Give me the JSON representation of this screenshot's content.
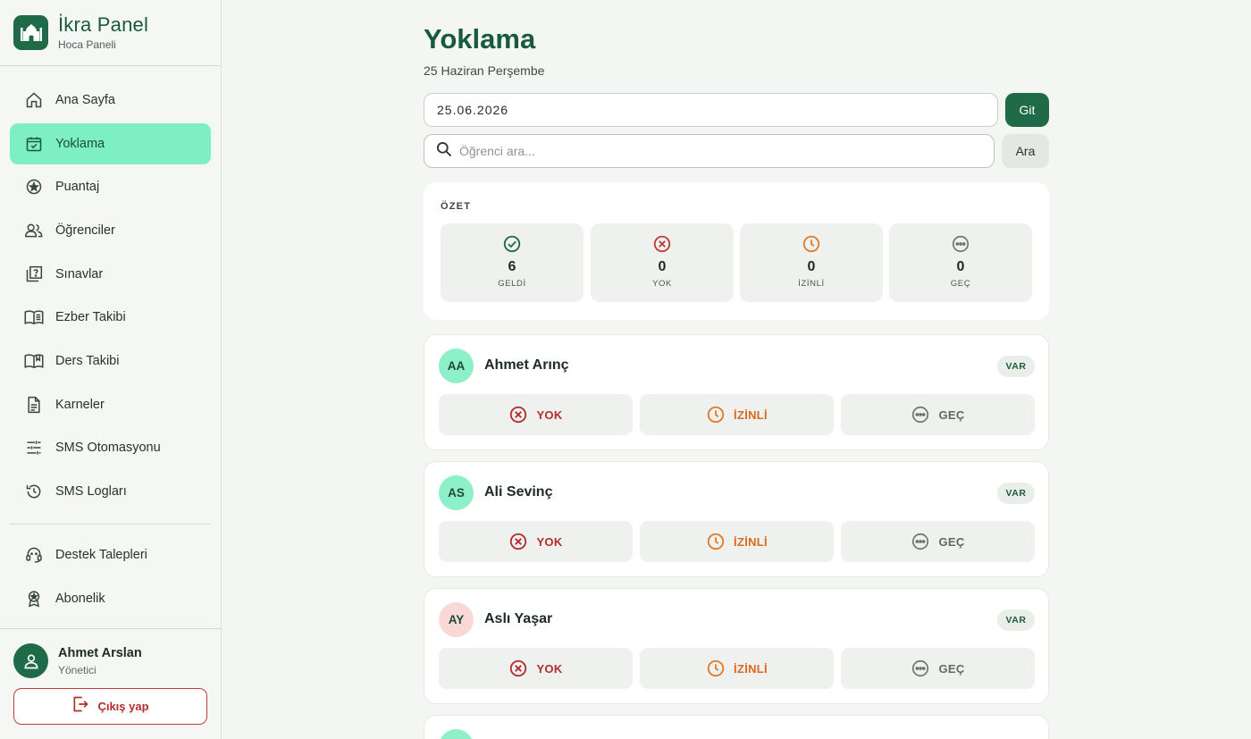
{
  "brand": {
    "title": "İkra Panel",
    "subtitle": "Hoca Paneli",
    "logo_icon": "mosque-icon"
  },
  "sidebar": {
    "items": [
      {
        "label": "Ana Sayfa",
        "icon": "home-icon",
        "active": false
      },
      {
        "label": "Yoklama",
        "icon": "calendar-check-icon",
        "active": true
      },
      {
        "label": "Puantaj",
        "icon": "star-circle-icon",
        "active": false
      },
      {
        "label": "Öğrenciler",
        "icon": "users-icon",
        "active": false
      },
      {
        "label": "Sınavlar",
        "icon": "quiz-icon",
        "active": false
      },
      {
        "label": "Ezber Takibi",
        "icon": "book-open-icon",
        "active": false
      },
      {
        "label": "Ders Takibi",
        "icon": "book-icon",
        "active": false
      },
      {
        "label": "Karneler",
        "icon": "document-icon",
        "active": false
      },
      {
        "label": "SMS Otomasyonu",
        "icon": "sliders-icon",
        "active": false
      },
      {
        "label": "SMS Logları",
        "icon": "history-icon",
        "active": false
      }
    ],
    "secondary": [
      {
        "label": "Destek Talepleri",
        "icon": "headset-icon"
      },
      {
        "label": "Abonelik",
        "icon": "badge-icon"
      }
    ],
    "user": {
      "name": "Ahmet Arslan",
      "role": "Yönetici"
    },
    "logout_label": "Çıkış yap"
  },
  "main": {
    "title": "Yoklama",
    "subtitle": "25 Haziran Perşembe",
    "date_value": "25.06.2026",
    "go_label": "Git",
    "search_placeholder": "Öğrenci ara...",
    "search_label": "Ara",
    "summary": {
      "title": "ÖZET",
      "stats": [
        {
          "value": "6",
          "label": "GELDİ",
          "color": "#1f6b47"
        },
        {
          "value": "0",
          "label": "YOK",
          "color": "#c23b3b"
        },
        {
          "value": "0",
          "label": "İZİNLİ",
          "color": "#e07a2b"
        },
        {
          "value": "0",
          "label": "GEÇ",
          "color": "#6b7570"
        }
      ]
    },
    "students": [
      {
        "initials": "AA",
        "name": "Ahmet Arınç",
        "status": "VAR",
        "avatar_color": "#8ef0c9"
      },
      {
        "initials": "AS",
        "name": "Ali Sevinç",
        "status": "VAR",
        "avatar_color": "#8ef0c9"
      },
      {
        "initials": "AY",
        "name": "Aslı Yaşar",
        "status": "VAR",
        "avatar_color": "#fbd8d8"
      }
    ],
    "actions": {
      "absent": "YOK",
      "excused": "İZİNLİ",
      "late": "GEÇ"
    }
  }
}
